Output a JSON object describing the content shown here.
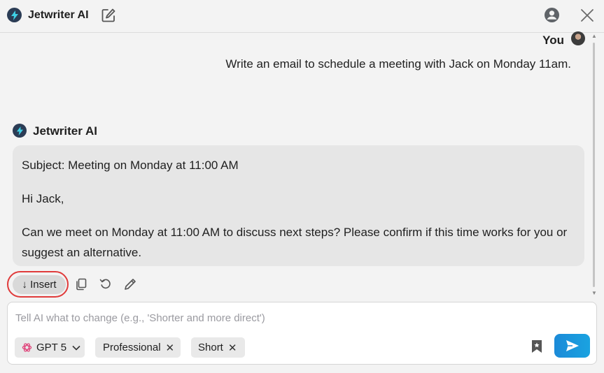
{
  "header": {
    "app_title": "Jetwriter AI",
    "icons": [
      "logo-icon",
      "edit-icon",
      "user-icon",
      "close-icon"
    ]
  },
  "chat": {
    "user_label": "You",
    "user_message": "Write an email to schedule a meeting with Jack on Monday 11am.",
    "ai_name": "Jetwriter AI",
    "ai_paragraphs": [
      "Subject: Meeting on Monday at 11:00 AM",
      "Hi Jack,",
      "Can we meet on Monday at 11:00 AM to discuss next steps? Please confirm if this time works for you or suggest an alternative."
    ]
  },
  "actions": {
    "insert_label": "↓ Insert",
    "icons": [
      "copy-icon",
      "regenerate-icon",
      "pencil-icon"
    ]
  },
  "composer": {
    "placeholder": "Tell AI what to change (e.g., 'Shorter and more direct')",
    "model_label": "GPT 5",
    "chips": [
      "Professional",
      "Short"
    ]
  },
  "colors": {
    "accent": "#1b8ad8",
    "highlight_ring": "#e03b3b",
    "logo_bg": "#2b3c55"
  }
}
